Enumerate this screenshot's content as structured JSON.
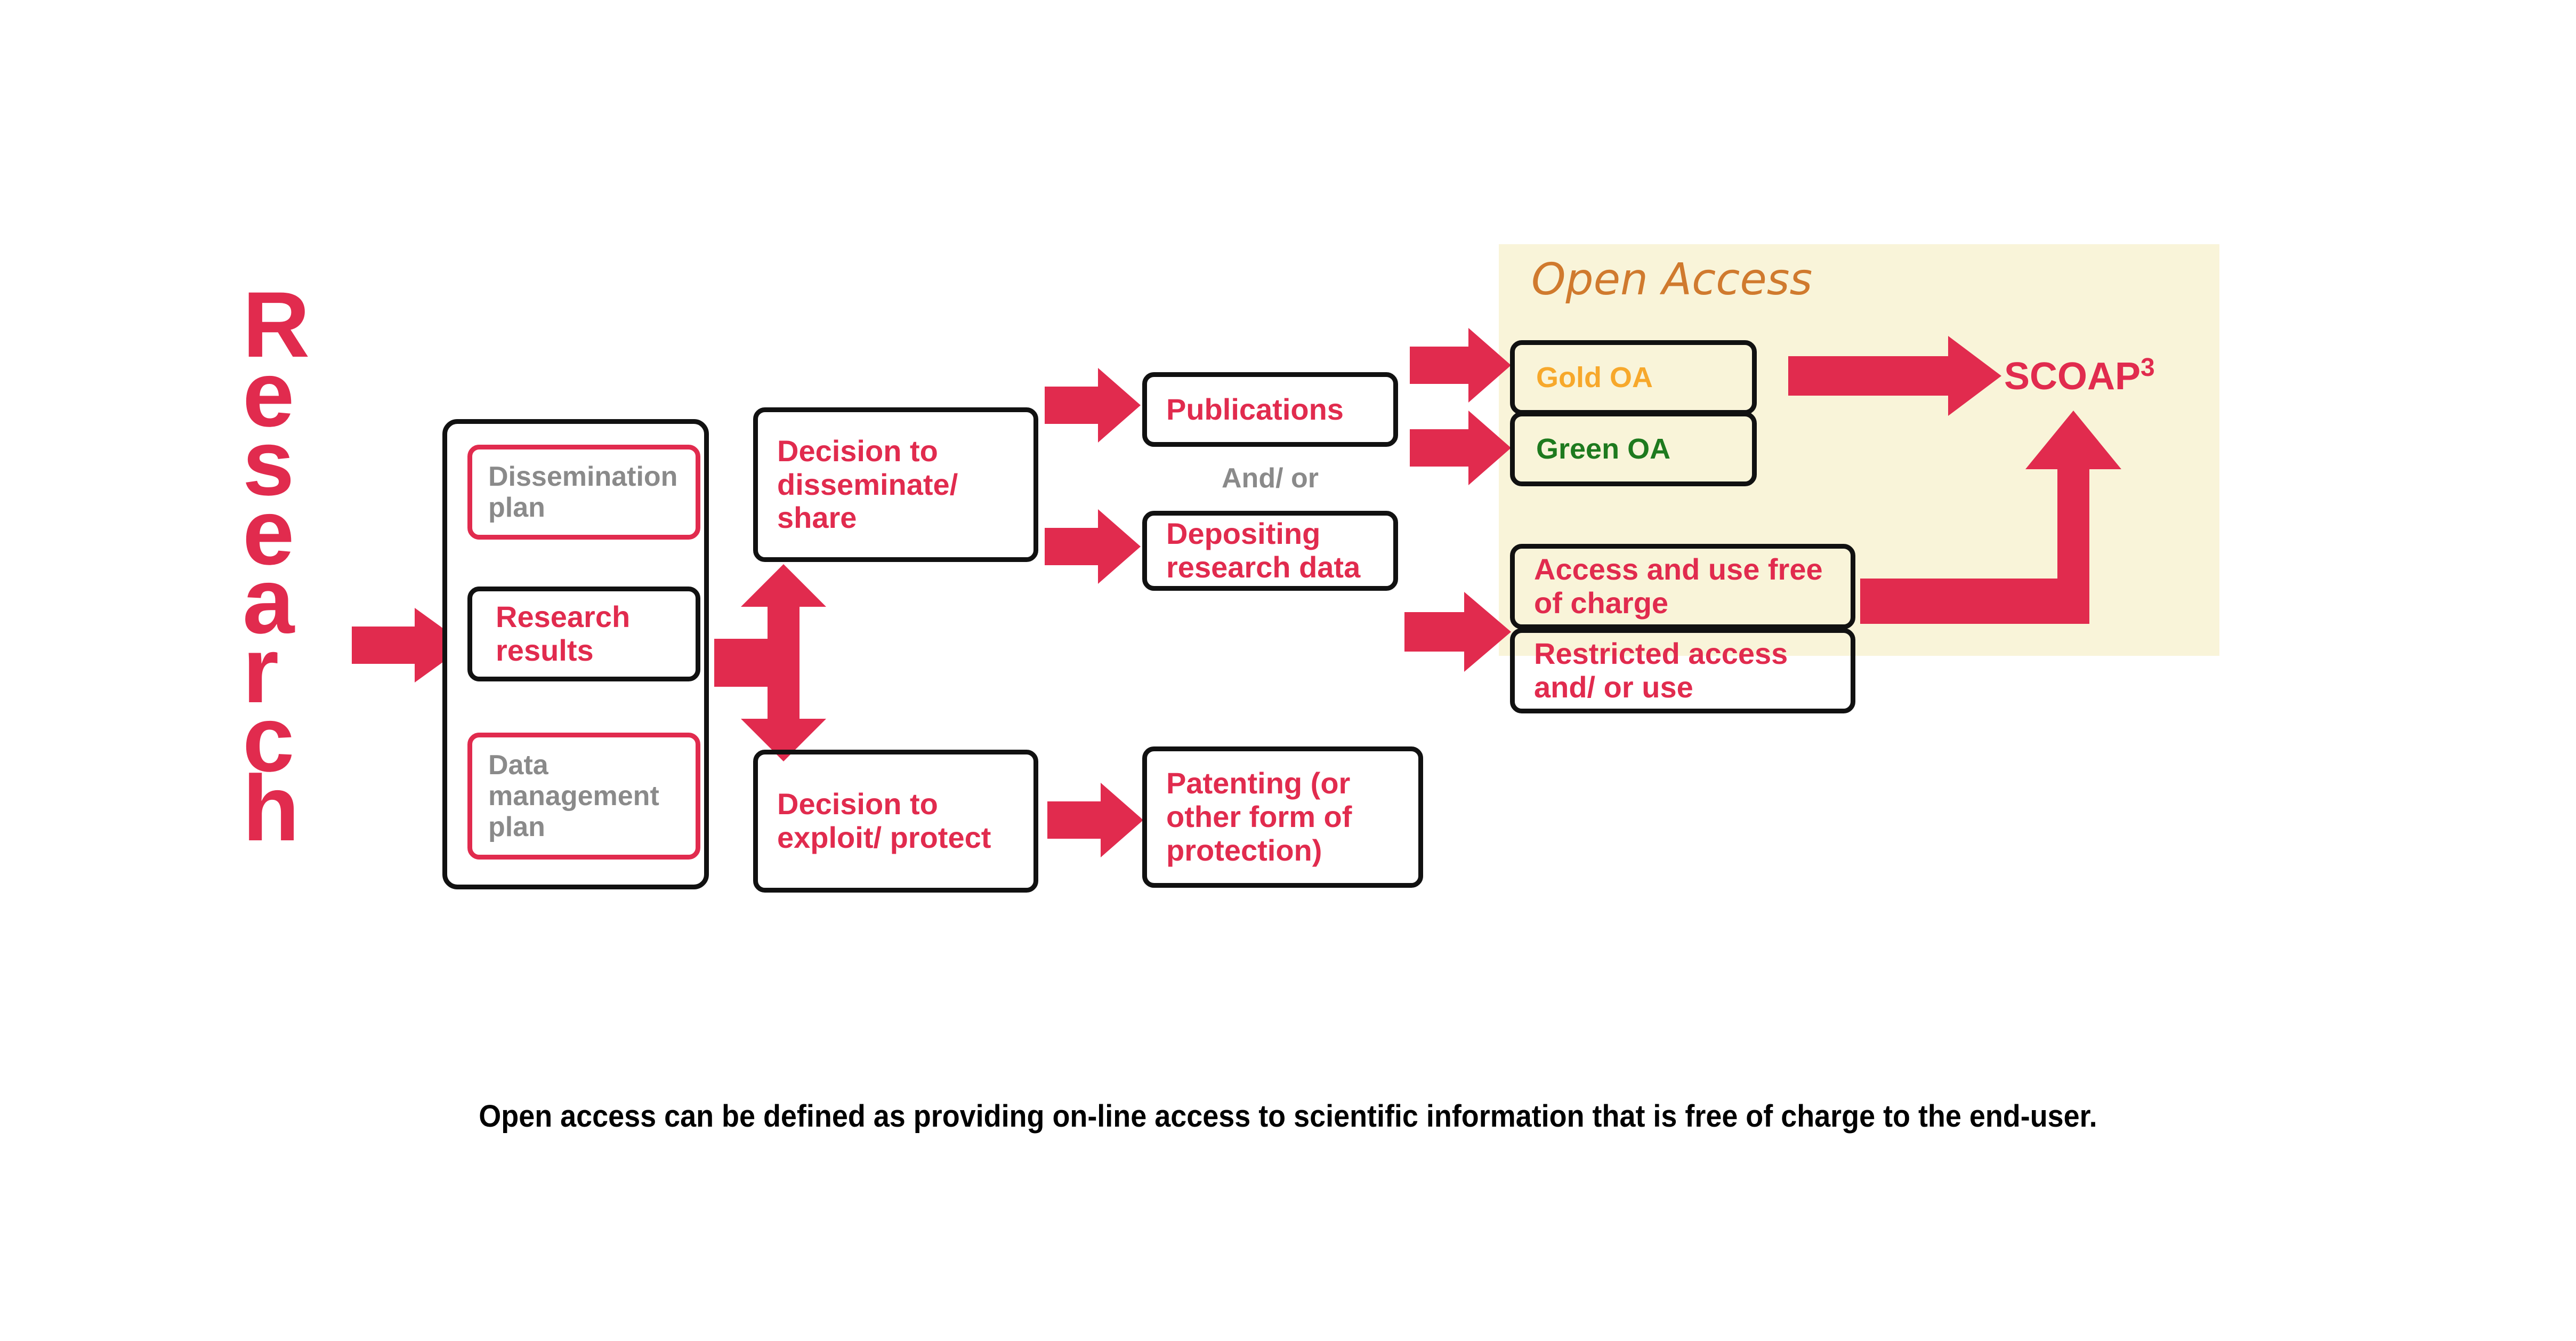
{
  "colors": {
    "red": "#E12B4E",
    "panel_bg": "#F9F4D9",
    "oa_title": "#D07A2E",
    "gold": "#F7A82B",
    "green": "#1E7A1E",
    "gray_text": "#8A8A8A",
    "black": "#111111"
  },
  "research_label": {
    "text": "Research",
    "letters": [
      "R",
      "e",
      "s",
      "e",
      "a",
      "r",
      "c",
      "h"
    ]
  },
  "research_container": {
    "dissemination_plan": "Dissemination plan",
    "research_results": "Research results",
    "data_management_plan": "Data management plan"
  },
  "decisions": {
    "disseminate": "Decision to disseminate/ share",
    "exploit": "Decision to exploit/ protect"
  },
  "outputs": {
    "publications": "Publications",
    "and_or": "And/ or",
    "depositing": "Depositing research data",
    "patenting": "Patenting (or other form of protection)"
  },
  "open_access": {
    "title": "Open Access",
    "gold_oa": "Gold OA",
    "green_oa": "Green OA",
    "scoap": "SCOAP",
    "scoap_sup": "3"
  },
  "access_terms": {
    "free": "Access and use free of charge",
    "restricted": "Restricted access and/ or use"
  },
  "caption": "Open access can be defined as providing on-line access to scientific information that is free of charge to the end-user."
}
